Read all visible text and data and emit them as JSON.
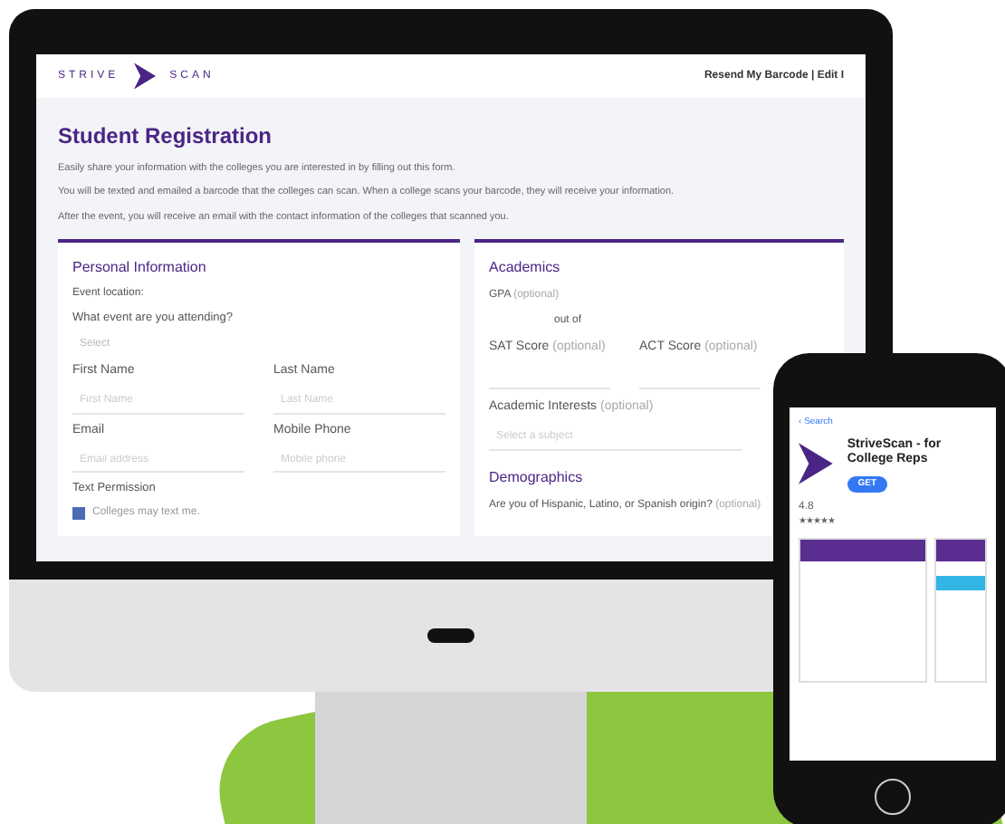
{
  "header": {
    "logo_left": "STRIVE",
    "logo_right": "SCAN",
    "links": "Resend My Barcode | Edit I"
  },
  "page": {
    "title": "Student Registration",
    "paragraphs": [
      "Easily share your information with the colleges you are interested in by filling out this form.",
      "You will be texted and emailed a barcode that the colleges can scan. When a college scans your barcode, they will receive your information.",
      "After the event, you will receive an email with the contact information of the colleges that scanned you."
    ]
  },
  "personal": {
    "title": "Personal Information",
    "event_location": "Event location:",
    "event_question": "What event are you attending?",
    "event_placeholder": "Select",
    "fields": [
      {
        "label": "First Name",
        "placeholder": "First Name"
      },
      {
        "label": "Last Name",
        "placeholder": "Last Name"
      },
      {
        "label": "Email",
        "placeholder": "Email address"
      },
      {
        "label": "Mobile Phone",
        "placeholder": "Mobile phone"
      }
    ],
    "permission": {
      "label": "Text Permission",
      "option": "Colleges may text me.",
      "checked": true
    }
  },
  "academics": {
    "title": "Academics",
    "gpa_label": "GPA",
    "gpa_optional": "(optional)",
    "out_of": "out of",
    "sat_label": "SAT Score",
    "sat_optional": "(optional)",
    "act_label": "ACT Score",
    "act_optional": "(optional)",
    "interests_label": "Academic Interests",
    "interests_optional": "(optional)",
    "interests_placeholder": "Select a subject"
  },
  "demographics": {
    "title": "Demographics",
    "question": "Are you of Hispanic, Latino, or Spanish origin?",
    "optional": "(optional)"
  },
  "phone": {
    "back_arrow": "‹",
    "back": "Search",
    "app_name": "StriveScan - for College Reps",
    "get": "GET",
    "rating": "4.8",
    "stars": 5
  }
}
